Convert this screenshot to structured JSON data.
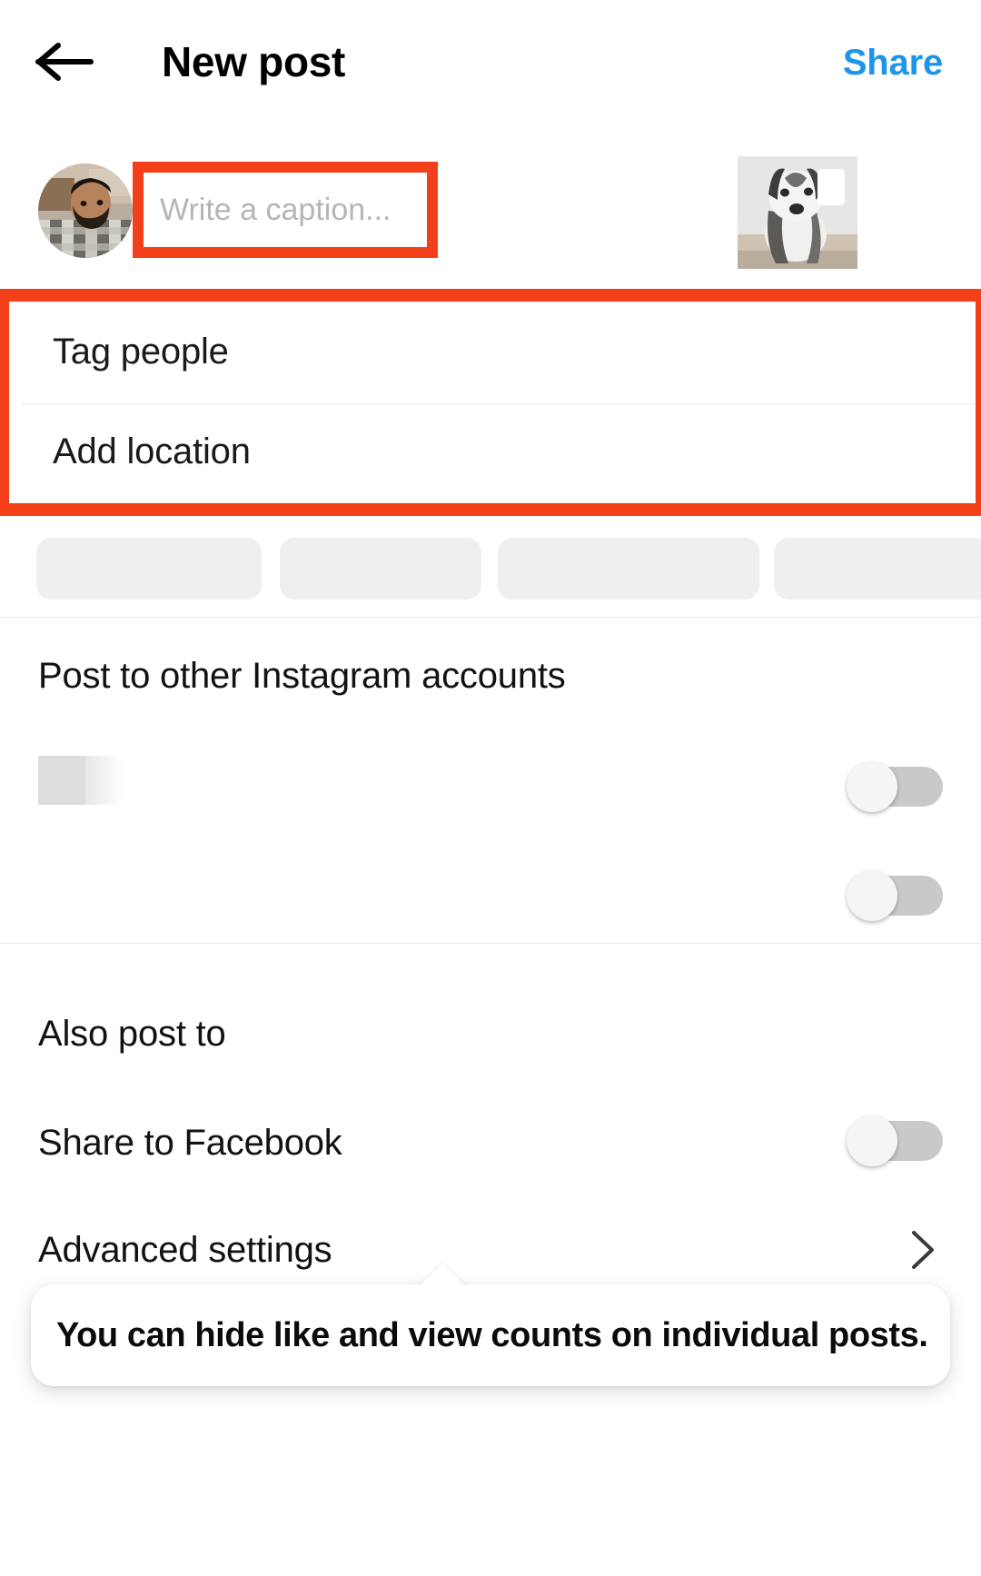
{
  "header": {
    "back_icon": "arrow-left-icon",
    "title": "New post",
    "share_label": "Share",
    "share_color": "#1e95e8"
  },
  "caption": {
    "avatar_icon": "user-avatar",
    "placeholder": "Write a caption...",
    "value": "",
    "thumbnail_icon": "post-thumbnail-dog",
    "highlight_color": "#f4401a"
  },
  "options": {
    "highlight_color": "#f4401a",
    "items": [
      {
        "label": "Tag people"
      },
      {
        "label": "Add location"
      }
    ]
  },
  "suggestion_chips": {
    "count": 4,
    "loading": true
  },
  "accounts_section": {
    "heading": "Post to other Instagram accounts",
    "toggles": [
      {
        "state": "off"
      },
      {
        "state": "off"
      }
    ]
  },
  "also_post_to": {
    "heading": "Also post to",
    "facebook": {
      "label": "Share to Facebook",
      "state": "off"
    },
    "advanced": {
      "label": "Advanced settings",
      "chevron_icon": "chevron-right-icon"
    }
  },
  "tooltip": {
    "text": "You can hide like and view counts on individual posts."
  }
}
